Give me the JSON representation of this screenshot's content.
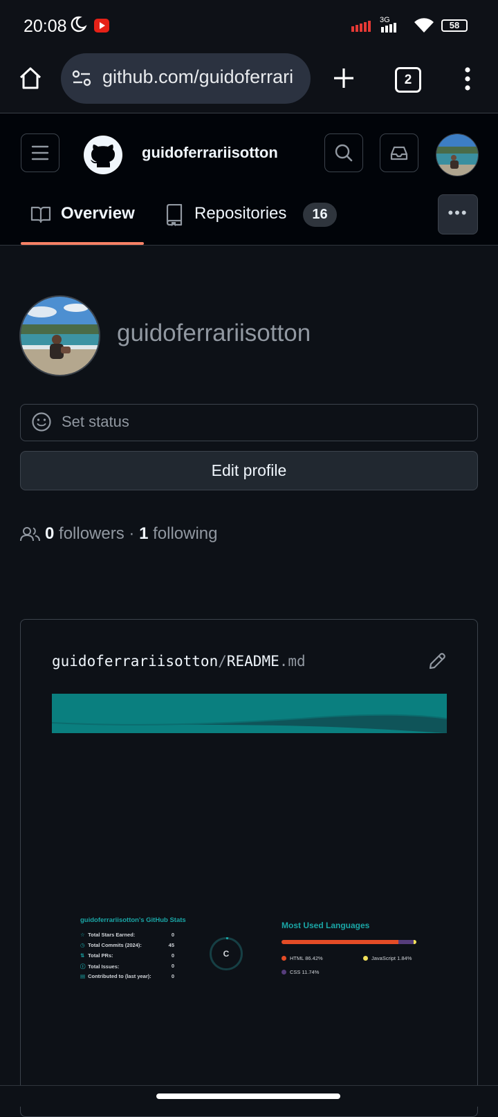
{
  "status_bar": {
    "time": "20:08",
    "network": "3G",
    "battery": "58"
  },
  "browser": {
    "url": "github.com/guidoferrari",
    "tab_count": "2"
  },
  "header": {
    "username": "guidoferrariisotton"
  },
  "tabs": [
    {
      "label": "Overview",
      "selected": true
    },
    {
      "label": "Repositories",
      "count": "16"
    }
  ],
  "profile": {
    "login": "guidoferrariisotton",
    "status_placeholder": "Set status",
    "edit_label": "Edit profile",
    "followers_count": "0",
    "followers_label": "followers",
    "separator": "·",
    "following_count": "1",
    "following_label": "following"
  },
  "readme": {
    "owner": "guidoferrariisotton",
    "sep": "/",
    "name": "README",
    "ext": ".md"
  },
  "stats": {
    "title": "guidoferrariisotton's GitHub Stats",
    "rows": [
      {
        "label": "Total Stars Earned:",
        "value": "0",
        "icon": "star-icon"
      },
      {
        "label": "Total Commits (2024):",
        "value": "45",
        "icon": "clock-icon"
      },
      {
        "label": "Total PRs:",
        "value": "0",
        "icon": "pr-icon"
      },
      {
        "label": "Total Issues:",
        "value": "0",
        "icon": "issue-icon"
      },
      {
        "label": "Contributed to (last year):",
        "value": "0",
        "icon": "repo-icon"
      }
    ],
    "rank": "C"
  },
  "languages": {
    "title": "Most Used Languages",
    "items": [
      {
        "label": "HTML 86.42%",
        "percent": 86.42,
        "color": "#e34c26"
      },
      {
        "label": "JavaScript 1.84%",
        "percent": 1.84,
        "color": "#f1e05a"
      },
      {
        "label": "CSS 11.74%",
        "percent": 11.74,
        "color": "#563d7c"
      }
    ]
  },
  "colors": {
    "accent_underline": "#f78166",
    "stats_teal": "#1aa6a6",
    "banner_teal": "#0a7f7f"
  }
}
